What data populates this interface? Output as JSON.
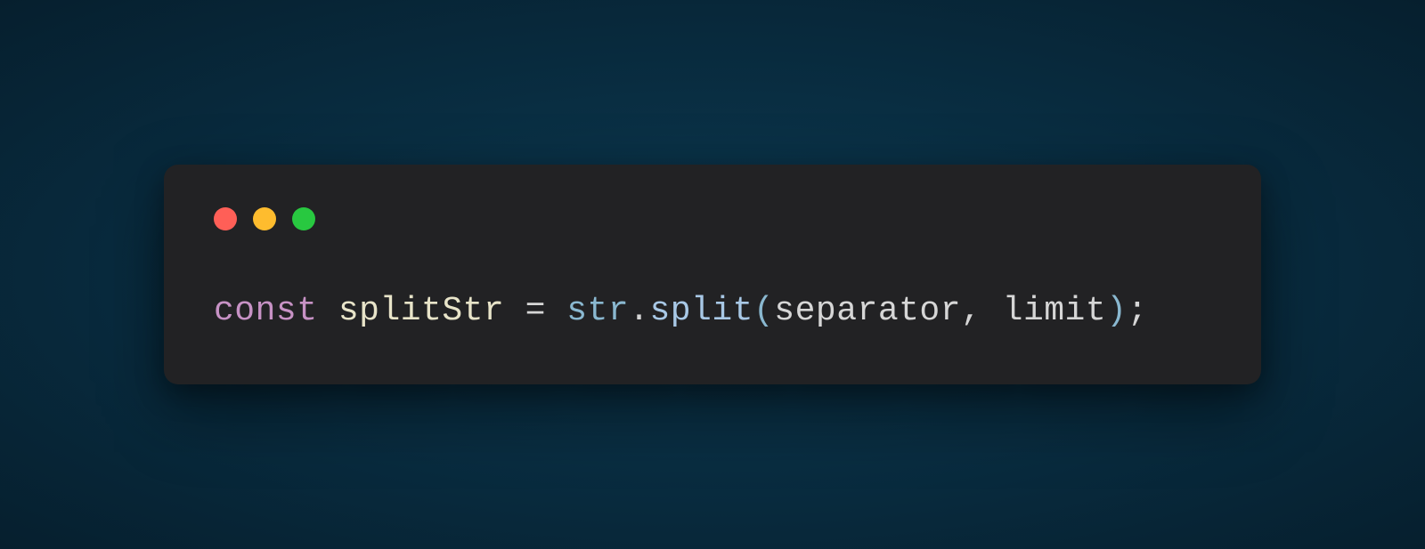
{
  "window": {
    "traffic_lights": {
      "close": "close",
      "minimize": "minimize",
      "maximize": "maximize"
    }
  },
  "code": {
    "tokens": {
      "keyword_const": "const",
      "space1": " ",
      "var_splitStr": "splitStr",
      "space2": " ",
      "op_assign": "=",
      "space3": " ",
      "obj_str": "str",
      "dot": ".",
      "method_split": "split",
      "paren_open": "(",
      "param_separator": "separator",
      "comma_sp": ", ",
      "param_limit": "limit",
      "paren_close": ")",
      "semicolon": ";"
    }
  }
}
